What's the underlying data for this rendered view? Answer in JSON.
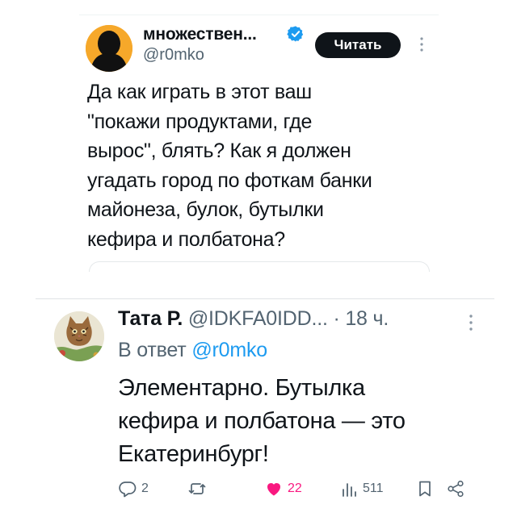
{
  "first_tweet": {
    "display_name": "множествен...",
    "handle": "@r0mko",
    "follow_button_label": "Читать",
    "text": "Да как играть в этот ваш\n\"покажи продуктами, где\nвырос\", блять? Как я должен\nугадать город по фоткам банки\nмайонеза, булок, бутылки\nкефира и полбатона?"
  },
  "reply": {
    "display_name": "Тата Р.",
    "handle": "@IDKFA0IDD...",
    "dot": "·",
    "time": "18 ч.",
    "reply_to_prefix": "В ответ",
    "reply_to_handle": "@r0mko",
    "text": "Элементарно. Бутылка\nкефира и полбатона — это\nЕкатеринбург!",
    "actions": {
      "replies": "2",
      "retweets": "",
      "likes": "22",
      "views": "511"
    }
  },
  "colors": {
    "text": "#0f1419",
    "secondary": "#536471",
    "link": "#1d9bf0",
    "like": "#f91880",
    "verified": "#1d9bf0",
    "button_bg": "#0f1419"
  },
  "icons": [
    "verified-badge-icon",
    "more-icon",
    "reply-icon",
    "retweet-icon",
    "like-icon",
    "views-icon",
    "bookmark-icon",
    "share-icon"
  ]
}
